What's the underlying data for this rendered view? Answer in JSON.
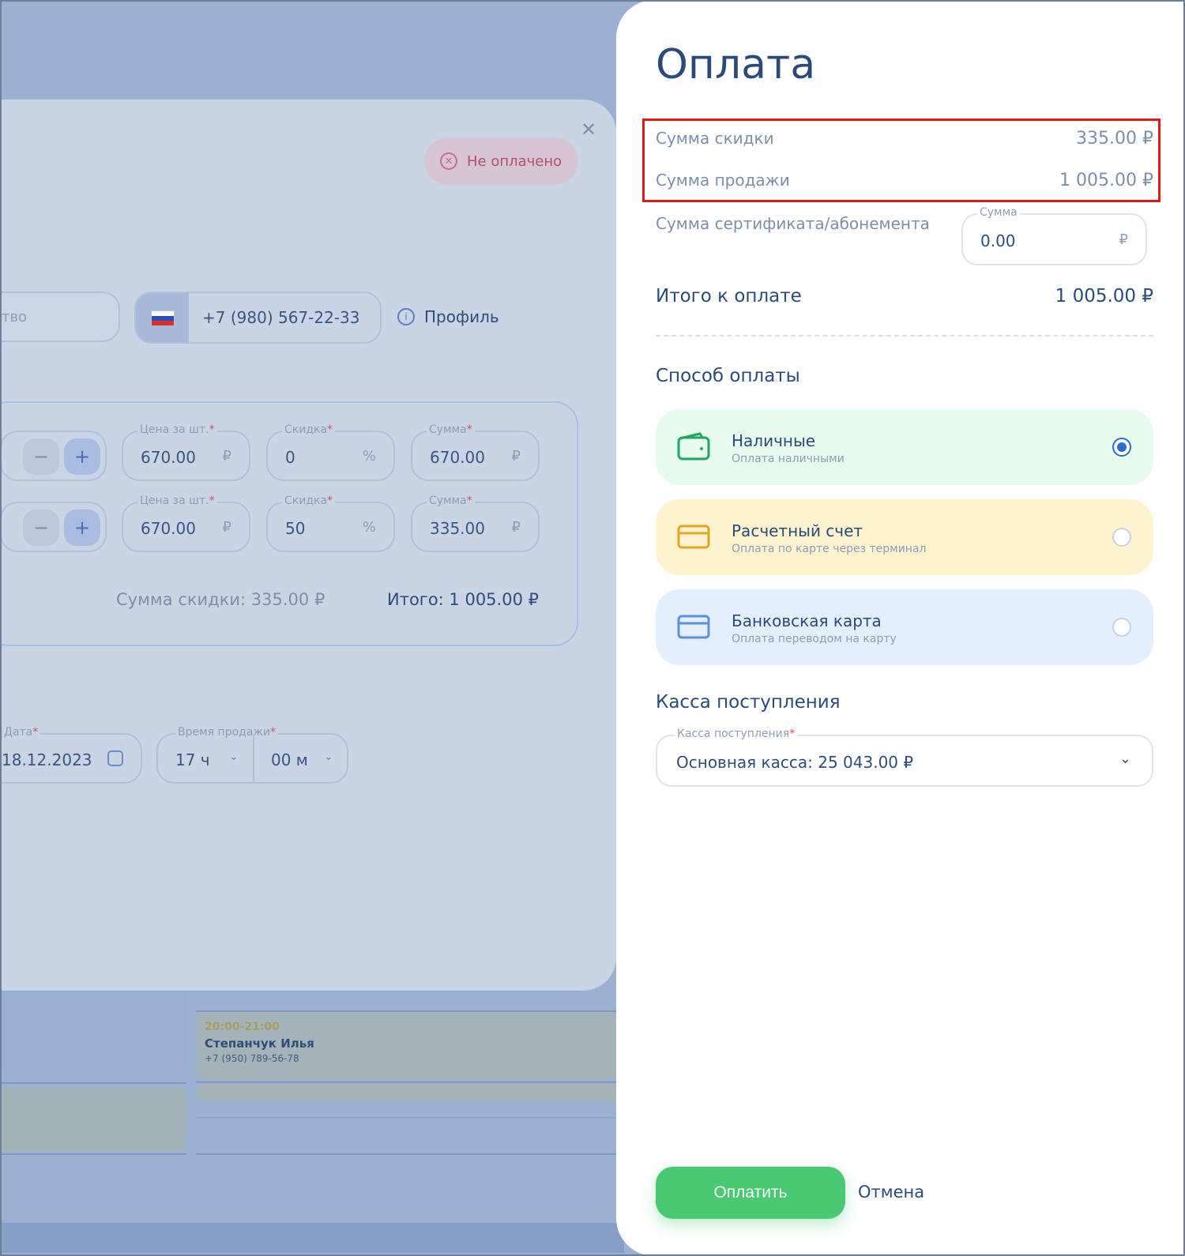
{
  "background": {
    "event": {
      "time": "20:00-21:00",
      "name": "Степанчук Илья",
      "phone": "+7 (950) 789-56-78"
    }
  },
  "sale_dialog": {
    "status": "Не оплачено",
    "name_placeholder": "тво",
    "phone": "+7 (980) 567-22-33",
    "profile_label": "Профиль",
    "items": [
      {
        "price_label": "Цена за шт.",
        "price": "670.00",
        "discount_label": "Скидка",
        "discount": "0",
        "sum_label": "Сумма",
        "sum": "670.00"
      },
      {
        "price_label": "Цена за шт.",
        "price": "670.00",
        "discount_label": "Скидка",
        "discount": "50",
        "sum_label": "Сумма",
        "sum": "335.00"
      }
    ],
    "currency": "₽",
    "percent": "%",
    "discount_total": "Сумма скидки: 335.00 ₽",
    "grand_total": "Итого: 1 005.00 ₽",
    "date_label": "Дата",
    "date": "18.12.2023",
    "time_label": "Время продажи",
    "hours": "17 ч",
    "minutes": "00 м",
    "required_mark": "*"
  },
  "payment": {
    "title": "Оплата",
    "discount_label": "Сумма скидки",
    "discount_value": "335.00 ₽",
    "sale_label": "Сумма продажи",
    "sale_value": "1 005.00 ₽",
    "cert_label": "Сумма сертификата/абонемента",
    "cert_input_label": "Сумма",
    "cert_value": "0.00",
    "currency": "₽",
    "total_label": "Итого к оплате",
    "total_value": "1 005.00 ₽",
    "method_heading": "Способ оплаты",
    "methods": [
      {
        "title": "Наличные",
        "subtitle": "Оплата наличными",
        "selected": true,
        "bg": "#e7fbef",
        "icon": "wallet-icon",
        "icon_color": "#1fa763"
      },
      {
        "title": "Расчетный счет",
        "subtitle": "Оплата по карте через терминал",
        "selected": false,
        "bg": "#fef3cf",
        "icon": "card-icon",
        "icon_color": "#e3a526"
      },
      {
        "title": "Банковская карта",
        "subtitle": "Оплата переводом на карту",
        "selected": false,
        "bg": "#e3effd",
        "icon": "card-icon",
        "icon_color": "#5b8fe0"
      }
    ],
    "cashbox_heading": "Касса поступления",
    "cashbox_label": "Касса поступления",
    "cashbox_value": "Основная касса: 25 043.00 ₽",
    "pay_button": "Оплатить",
    "cancel_button": "Отмена"
  }
}
